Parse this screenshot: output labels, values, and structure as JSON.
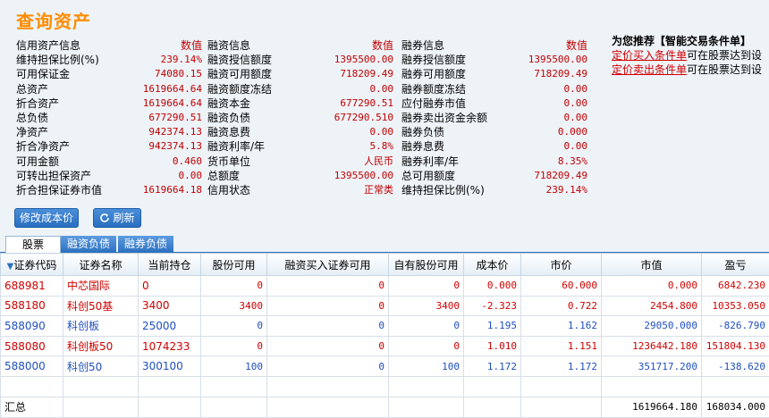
{
  "title": "查询资产",
  "credit_columns": [
    {
      "header": {
        "label": "信用资产信息",
        "value": "数值"
      },
      "rows": [
        {
          "label": "维持担保比例(%)",
          "value": "239.14%"
        },
        {
          "label": "可用保证金",
          "value": "74080.15"
        },
        {
          "label": "总资产",
          "value": "1619664.64"
        },
        {
          "label": "折合资产",
          "value": "1619664.64"
        },
        {
          "label": "总负债",
          "value": "677290.51"
        },
        {
          "label": "净资产",
          "value": "942374.13"
        },
        {
          "label": "折合净资产",
          "value": "942374.13"
        },
        {
          "label": "可用金额",
          "value": "0.460"
        },
        {
          "label": "可转出担保资产",
          "value": "0.00"
        },
        {
          "label": "折合担保证券市值",
          "value": "1619664.18"
        }
      ]
    },
    {
      "header": {
        "label": "融资信息",
        "value": "数值"
      },
      "rows": [
        {
          "label": "融资授信额度",
          "value": "1395500.00"
        },
        {
          "label": "融资可用额度",
          "value": "718209.49"
        },
        {
          "label": "融资额度冻结",
          "value": "0.00"
        },
        {
          "label": "融资本金",
          "value": "677290.51"
        },
        {
          "label": "融资负债",
          "value": "677290.510"
        },
        {
          "label": "融资息费",
          "value": "0.00"
        },
        {
          "label": "融资利率/年",
          "value": "5.8%"
        },
        {
          "label": "货币单位",
          "value": "人民币"
        },
        {
          "label": "总额度",
          "value": "1395500.00"
        },
        {
          "label": "信用状态",
          "value": "正常类"
        }
      ]
    },
    {
      "header": {
        "label": "融券信息",
        "value": "数值"
      },
      "rows": [
        {
          "label": "融券授信额度",
          "value": "1395500.00"
        },
        {
          "label": "融券可用额度",
          "value": "718209.49"
        },
        {
          "label": "融券额度冻结",
          "value": "0.00"
        },
        {
          "label": "应付融券市值",
          "value": "0.00"
        },
        {
          "label": "融券卖出资金余额",
          "value": "0.00"
        },
        {
          "label": "融券负债",
          "value": "0.000"
        },
        {
          "label": "融券息费",
          "value": "0.00"
        },
        {
          "label": "融券利率/年",
          "value": "8.35%"
        },
        {
          "label": "总可用额度",
          "value": "718209.49"
        },
        {
          "label": "维持担保比例(%)",
          "value": "239.14%"
        }
      ]
    }
  ],
  "recommend": {
    "title": "为您推荐【智能交易条件单】",
    "lines": [
      {
        "link": "定价买入条件单",
        "text": "可在股票达到设"
      },
      {
        "link": "定价卖出条件单",
        "text": "可在股票达到设"
      }
    ]
  },
  "buttons": {
    "modify_cost": "修改成本价",
    "refresh": "刷新"
  },
  "tabs": [
    "股票",
    "融资负债",
    "融券负债"
  ],
  "table": {
    "sort_icon": "▼",
    "headers": [
      "证券代码",
      "证券名称",
      "当前持仓",
      "股份可用",
      "融资买入证券可用",
      "自有股份可用",
      "成本价",
      "市价",
      "市值",
      "盈亏"
    ],
    "rows": [
      {
        "color": "red",
        "cells": [
          "688981",
          "中芯国际",
          "0",
          "0",
          "0",
          "0",
          "0.000",
          "60.000",
          "0.000",
          "6842.230"
        ]
      },
      {
        "color": "red",
        "cells": [
          "588180",
          "科创50基",
          "3400",
          "3400",
          "0",
          "3400",
          "-2.323",
          "0.722",
          "2454.800",
          "10353.050"
        ]
      },
      {
        "color": "blue",
        "cells": [
          "588090",
          "科创板",
          "25000",
          "0",
          "0",
          "0",
          "1.195",
          "1.162",
          "29050.000",
          "-826.790"
        ]
      },
      {
        "color": "red",
        "cells": [
          "588080",
          "科创板50",
          "1074233",
          "0",
          "0",
          "0",
          "1.010",
          "1.151",
          "1236442.180",
          "151804.130"
        ]
      },
      {
        "color": "blue",
        "cells": [
          "588000",
          "科创50",
          "300100",
          "100",
          "0",
          "100",
          "1.172",
          "1.172",
          "351717.200",
          "-138.620"
        ]
      }
    ],
    "total": {
      "label": "汇总",
      "market_value": "1619664.180",
      "profit": "168034.000"
    }
  },
  "colors": {
    "title": "#ff8c00",
    "value_red": "#c00000",
    "up_red": "#d00000",
    "down_blue": "#1f4fbf",
    "accent_blue": "#2a6fc0"
  }
}
